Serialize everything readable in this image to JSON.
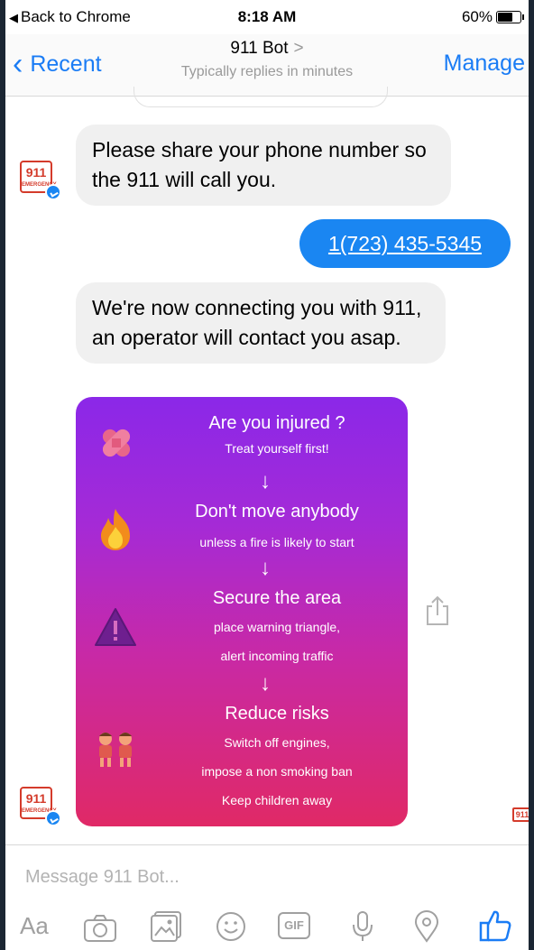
{
  "status_bar": {
    "back": "Back to Chrome",
    "time": "8:18 AM",
    "battery": "60%"
  },
  "nav": {
    "back_label": "Recent",
    "title": "911 Bot",
    "subtitle": "Typically replies in minutes",
    "manage_label": "Manage"
  },
  "messages": [
    {
      "text": "Please share your phone number so the 911 will call you."
    },
    {
      "text": "1(723) 435-5345"
    },
    {
      "text": "We're now connecting you with 911, an operator will contact you asap."
    }
  ],
  "avatar_logo": {
    "number": "911",
    "word": "EMERGENCY"
  },
  "card": {
    "steps": [
      {
        "title": "Are you injured ?",
        "lines": [
          "Treat yourself first!"
        ]
      },
      {
        "title": "Don't move anybody",
        "lines": [
          "unless a fire is likely to start"
        ]
      },
      {
        "title": "Secure the area",
        "lines": [
          "place warning triangle,",
          "alert incoming traffic"
        ]
      },
      {
        "title": "Reduce risks",
        "lines": [
          "Switch off engines,",
          "impose a non smoking ban",
          "Keep children away"
        ]
      }
    ],
    "arrow": "↓"
  },
  "composer": {
    "placeholder": "Message 911 Bot...",
    "aa": "Aa",
    "gif": "GIF"
  },
  "colors": {
    "accent": "#1a7cf5",
    "outgoing": "#1a86f2",
    "card_top": "#8b28e8",
    "card_bottom": "#e02966",
    "brand_red": "#d43b2b"
  }
}
